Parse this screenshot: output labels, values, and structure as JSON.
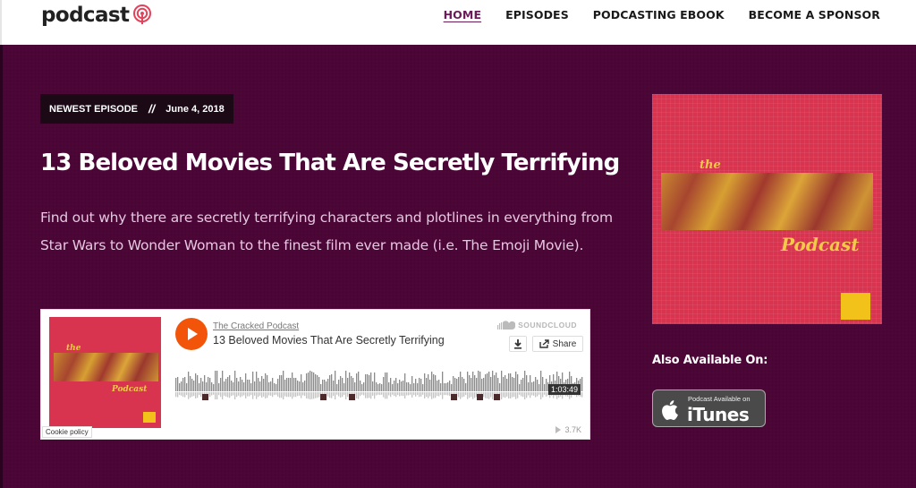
{
  "header": {
    "logo_text": "podcast",
    "nav": [
      "HOME",
      "EPISODES",
      "PODCASTING EBOOK",
      "BECOME A SPONSOR"
    ]
  },
  "hero": {
    "newest_label": "NEWEST EPISODE",
    "separator": "//",
    "date": "June 4, 2018",
    "title": "13 Beloved Movies That Are Secretly Terrifying",
    "description": "Find out why there are secretly terrifying characters and plotlines in everything from Star Wars to Wonder Woman to the finest film ever made (i.e. The Emoji Movie)."
  },
  "player": {
    "uploader": "The Cracked Podcast",
    "track_title": "13 Beloved Movies That Are Secretly Terrifying",
    "brand": "SOUNDCLOUD",
    "share_label": "Share",
    "duration": "1:03:49",
    "play_count": "3.7K",
    "cookie_label": "Cookie policy",
    "art_the": "the",
    "art_podcast": "Podcast"
  },
  "sidebar": {
    "cover_the": "the",
    "cover_podcast": "Podcast",
    "also_available": "Also Available On:",
    "itunes_small": "Podcast Available on",
    "itunes_big": "iTunes"
  },
  "colors": {
    "hero_bg": "#4d0638",
    "accent": "#6b1b5a",
    "play_orange": "#f2550a",
    "cover_red": "#d8344f",
    "cover_yellow": "#f3c94a"
  }
}
